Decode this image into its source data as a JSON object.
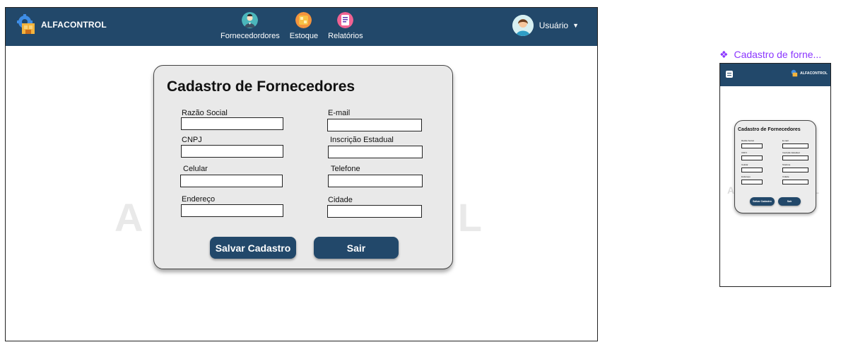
{
  "app": {
    "brand_name": "ALFACONTROL"
  },
  "nav": {
    "items": [
      {
        "label": "Fornecedordores",
        "icon": "supplier-icon"
      },
      {
        "label": "Estoque",
        "icon": "inventory-icon"
      },
      {
        "label": "Relatórios",
        "icon": "reports-icon"
      }
    ],
    "user_label": "Usuário",
    "user_icon": "user-avatar-icon",
    "dropdown_icon": "caret-down-icon"
  },
  "form": {
    "title": "Cadastro de Fornecedores",
    "fields": [
      {
        "label": "Razão Social",
        "value": ""
      },
      {
        "label": "E-mail",
        "value": ""
      },
      {
        "label": "CNPJ",
        "value": ""
      },
      {
        "label": "Inscrição Estadual",
        "value": ""
      },
      {
        "label": "Celular",
        "value": ""
      },
      {
        "label": "Telefone",
        "value": ""
      },
      {
        "label": "Endereço",
        "value": ""
      },
      {
        "label": "Cidade",
        "value": ""
      }
    ],
    "buttons": {
      "save": "Salvar Cadastro",
      "exit": "Sair"
    }
  },
  "watermark": {
    "left": "A",
    "right": "L"
  },
  "mobile_preview": {
    "title": "Cadastro de forne...",
    "diamond": "❖",
    "brand_name": "ALFACONTROL",
    "form_title": "Cadastro de Fornecedores",
    "fields": [
      {
        "label": "Razão Social"
      },
      {
        "label": "E-mail"
      },
      {
        "label": "CNPJ"
      },
      {
        "label": "Inscrição Estadual"
      },
      {
        "label": "Celular"
      },
      {
        "label": "Telefone"
      },
      {
        "label": "Endereço"
      },
      {
        "label": "Cidade"
      }
    ],
    "buttons": {
      "save": "Salvar Cadastro",
      "exit": "Sair"
    },
    "watermark_left": "A",
    "watermark_right": "L"
  },
  "colors": {
    "navbar": "#22486a",
    "button": "#22486a",
    "card": "#e9e9e9",
    "mobile_title": "#8b36ff",
    "watermark": "#e9e9e9"
  }
}
